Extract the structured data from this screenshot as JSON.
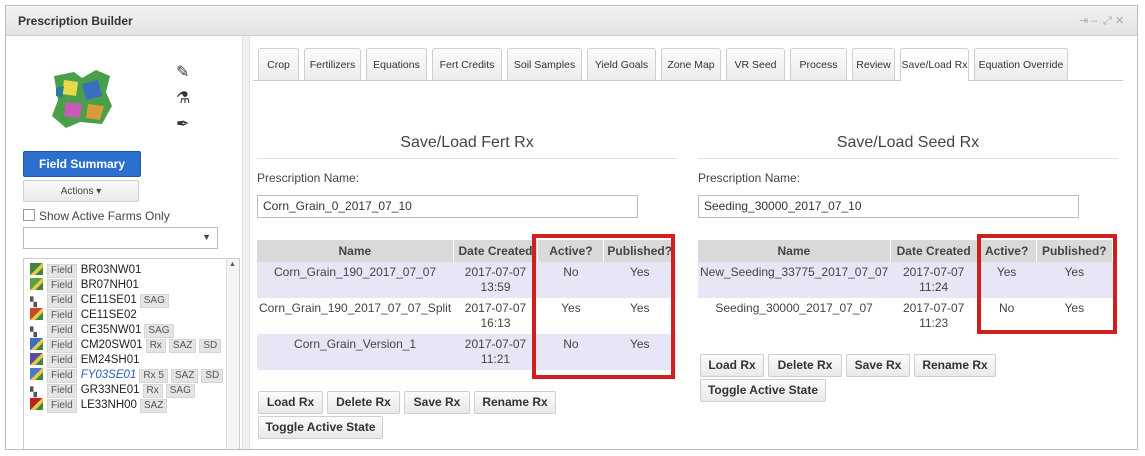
{
  "window": {
    "title": "Prescription Builder",
    "controls": [
      "⇥",
      "–",
      "⤢",
      "✕"
    ]
  },
  "sidebar": {
    "field_summary_label": "Field Summary",
    "actions_label": "Actions ▾",
    "show_active_label": "Show Active Farms Only",
    "fields": [
      {
        "tag": "Field",
        "name": "BR03NW01",
        "badges": [],
        "icon_color": "#3a8a3a"
      },
      {
        "tag": "Field",
        "name": "BR07NH01",
        "badges": [],
        "icon_color": "#5aa040"
      },
      {
        "tag": "Field",
        "name": "CE11SE01",
        "badges": [
          "SAG"
        ],
        "icon_color": "#555",
        "icon_g": true
      },
      {
        "tag": "Field",
        "name": "CE11SE02",
        "badges": [],
        "icon_color": "#c44a2a"
      },
      {
        "tag": "Field",
        "name": "CE35NW01",
        "badges": [
          "SAG"
        ],
        "icon_color": "#555",
        "icon_g": true
      },
      {
        "tag": "Field",
        "name": "CM20SW01",
        "badges": [
          "Rx",
          "SAZ",
          "SD"
        ],
        "icon_color": "#3a6fbf"
      },
      {
        "tag": "Field",
        "name": "EM24SH01",
        "badges": [],
        "icon_color": "#5a4aa0"
      },
      {
        "tag": "Field",
        "name": "FY03SE01",
        "badges": [
          "Rx 5",
          "SAZ",
          "SD"
        ],
        "icon_color": "#4a7acc",
        "selected": true
      },
      {
        "tag": "Field",
        "name": "GR33NE01",
        "badges": [
          "Rx",
          "SAG"
        ],
        "icon_color": "#555",
        "icon_g": true
      },
      {
        "tag": "Field",
        "name": "LE33NH00",
        "badges": [
          "SAZ"
        ],
        "icon_color": "#b82020"
      }
    ]
  },
  "tabs": [
    "Crop",
    "Fertilizers",
    "Equations",
    "Fert Credits",
    "Soil Samples",
    "Yield Goals",
    "Zone Map",
    "VR Seed",
    "Process",
    "Review",
    "Save/Load Rx",
    "Equation Override"
  ],
  "active_tab": "Save/Load Rx",
  "fert": {
    "title": "Save/Load Fert Rx",
    "name_label": "Prescription Name:",
    "name_value": "Corn_Grain_0_2017_07_10",
    "headers": [
      "Name",
      "Date Created",
      "Active?",
      "Published?"
    ],
    "rows": [
      {
        "name": "Corn_Grain_190_2017_07_07",
        "date1": "2017-07-07",
        "date2": "13:59",
        "active": "No",
        "published": "Yes"
      },
      {
        "name": "Corn_Grain_190_2017_07_07_Split",
        "date1": "2017-07-07",
        "date2": "16:13",
        "active": "Yes",
        "published": "Yes"
      },
      {
        "name": "Corn_Grain_Version_1",
        "date1": "2017-07-07",
        "date2": "11:21",
        "active": "No",
        "published": "Yes"
      }
    ],
    "buttons": {
      "load": "Load Rx",
      "delete": "Delete Rx",
      "save": "Save Rx",
      "rename": "Rename Rx",
      "toggle": "Toggle Active State"
    }
  },
  "seed": {
    "title": "Save/Load Seed Rx",
    "name_label": "Prescription Name:",
    "name_value": "Seeding_30000_2017_07_10",
    "headers": [
      "Name",
      "Date Created",
      "Active?",
      "Published?"
    ],
    "rows": [
      {
        "name": "New_Seeding_33775_2017_07_07",
        "date1": "2017-07-07",
        "date2": "11:24",
        "active": "Yes",
        "published": "Yes"
      },
      {
        "name": "Seeding_30000_2017_07_07",
        "date1": "2017-07-07",
        "date2": "11:23",
        "active": "No",
        "published": "Yes"
      }
    ],
    "buttons": {
      "load": "Load Rx",
      "delete": "Delete Rx",
      "save": "Save Rx",
      "rename": "Rename Rx",
      "toggle": "Toggle Active State"
    }
  },
  "colors": {
    "highlight": "#d01f1f",
    "primary": "#2c6fcf",
    "row_alt": "#e6e6f6",
    "header": "#d9d9d9"
  }
}
